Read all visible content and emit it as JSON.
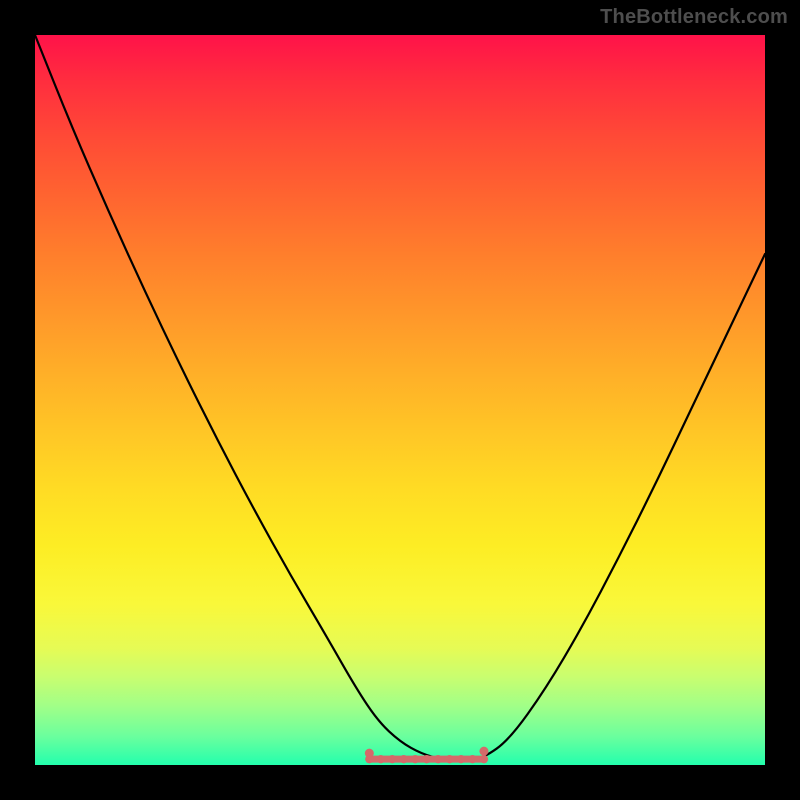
{
  "watermark": "TheBottleneck.com",
  "chart_data": {
    "type": "line",
    "title": "",
    "xlabel": "",
    "ylabel": "",
    "x_range": [
      0,
      1
    ],
    "y_range": [
      0,
      1
    ],
    "grid": false,
    "legend": false,
    "series": [
      {
        "name": "curve",
        "x": [
          0.0,
          0.05,
          0.1,
          0.15,
          0.2,
          0.25,
          0.3,
          0.35,
          0.4,
          0.44,
          0.47,
          0.5,
          0.53,
          0.56,
          0.59,
          0.615,
          0.65,
          0.7,
          0.75,
          0.8,
          0.85,
          0.9,
          0.95,
          1.0
        ],
        "y": [
          1.0,
          0.875,
          0.76,
          0.65,
          0.545,
          0.445,
          0.35,
          0.26,
          0.175,
          0.105,
          0.06,
          0.032,
          0.015,
          0.007,
          0.005,
          0.01,
          0.035,
          0.105,
          0.19,
          0.285,
          0.385,
          0.49,
          0.595,
          0.7
        ]
      }
    ],
    "flat_segment": {
      "x_start": 0.458,
      "x_end": 0.615,
      "y": 0.008,
      "color": "#d46a6a",
      "dot_count": 11
    },
    "gradient_stops": [
      {
        "pos": 0.0,
        "color": "#ff1249"
      },
      {
        "pos": 0.5,
        "color": "#ffc024"
      },
      {
        "pos": 0.8,
        "color": "#f4fa3c"
      },
      {
        "pos": 1.0,
        "color": "#23ffad"
      }
    ]
  }
}
